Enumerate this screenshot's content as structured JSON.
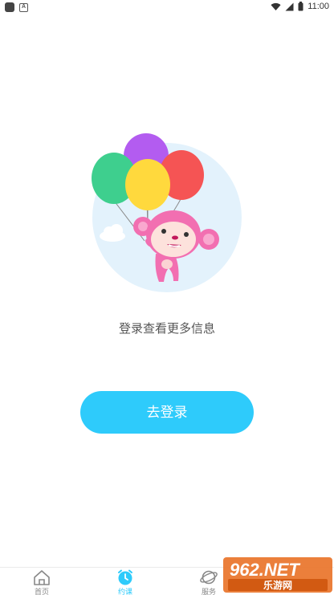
{
  "status_bar": {
    "time": "11:00",
    "icons": [
      "app-notification-icon",
      "a-badge-icon",
      "wifi-icon",
      "signal-icon",
      "battery-icon"
    ]
  },
  "main": {
    "illustration": "monkey-with-balloons",
    "prompt_text": "登录查看更多信息",
    "login_button_label": "去登录"
  },
  "tab_bar": {
    "tabs": [
      {
        "label": "首页",
        "icon": "home-icon",
        "active": false
      },
      {
        "label": "约课",
        "icon": "alarm-clock-icon",
        "active": true
      },
      {
        "label": "服务",
        "icon": "planet-icon",
        "active": false
      }
    ]
  },
  "watermark": {
    "brand": "962.NET",
    "sub": "乐游网"
  },
  "colors": {
    "accent": "#2ecbfb",
    "balloon_green": "#3ecf8e",
    "balloon_purple": "#b35cf0",
    "balloon_yellow": "#ffd93d",
    "balloon_red": "#f55454",
    "monkey_pink": "#f26fb1",
    "circle_bg": "#e3f2fc"
  }
}
